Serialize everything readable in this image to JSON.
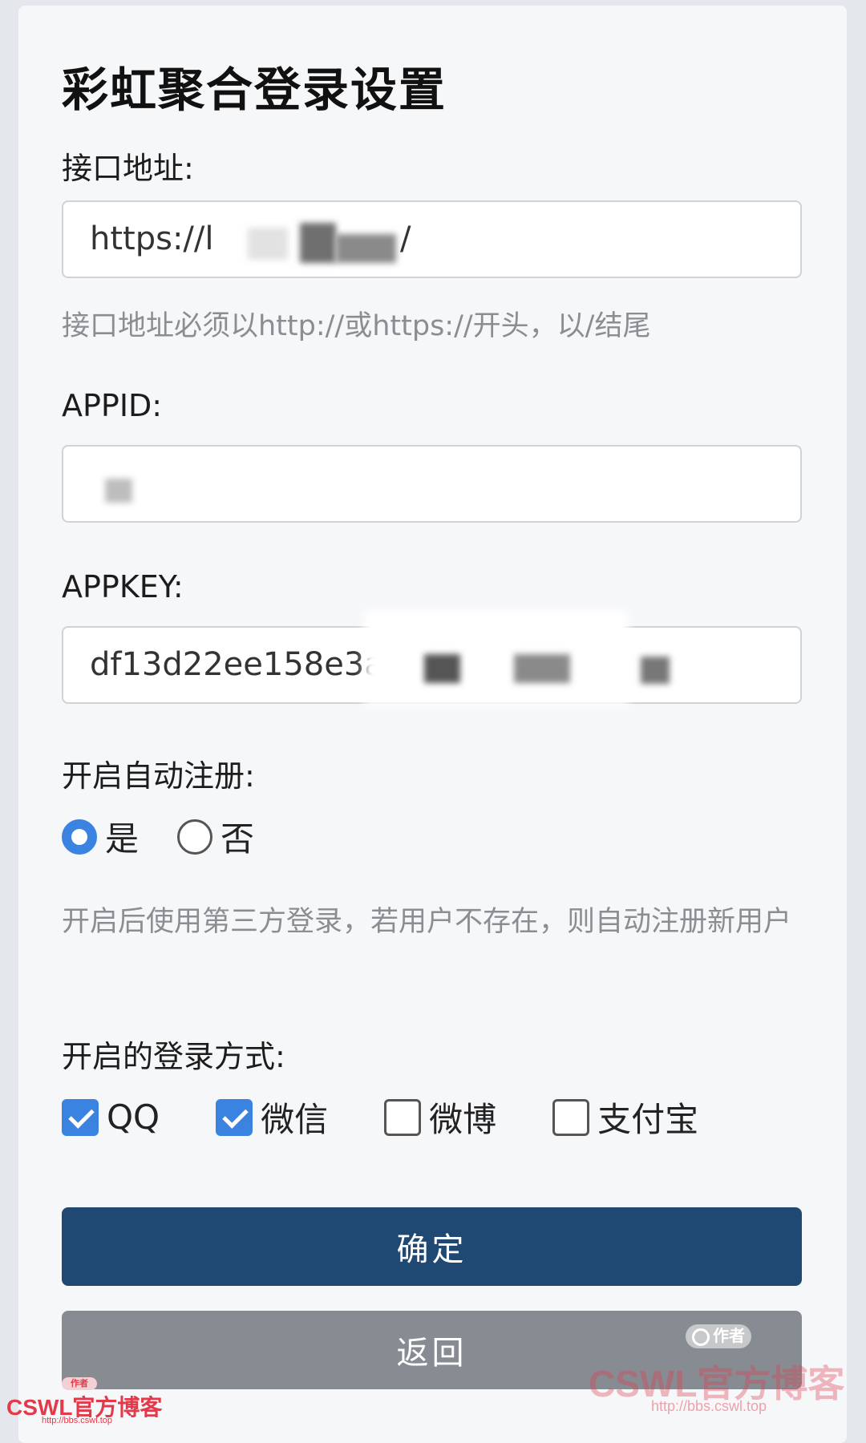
{
  "page": {
    "title": "彩虹聚合登录设置"
  },
  "api_address": {
    "label": "接口地址:",
    "value_visible": "https://l",
    "value_tail": "/",
    "help": "接口地址必须以http://或https://开头，以/结尾"
  },
  "appid": {
    "label": "APPID:",
    "value_visible": ""
  },
  "appkey": {
    "label": "APPKEY:",
    "value_visible": "df13d22ee158e3a493ef"
  },
  "auto_register": {
    "label": "开启自动注册:",
    "options": [
      {
        "label": "是",
        "checked": true
      },
      {
        "label": "否",
        "checked": false
      }
    ],
    "help": "开启后使用第三方登录，若用户不存在，则自动注册新用户"
  },
  "login_methods": {
    "label": "开启的登录方式:",
    "options": [
      {
        "label": "QQ",
        "checked": true
      },
      {
        "label": "微信",
        "checked": true
      },
      {
        "label": "微博",
        "checked": false
      },
      {
        "label": "支付宝",
        "checked": false
      }
    ]
  },
  "buttons": {
    "confirm": "确定",
    "back": "返回"
  },
  "watermarks": {
    "brand": "CSWL官方博客",
    "url": "http://bbs.cswl.top",
    "author_tag": "作者"
  },
  "colors": {
    "primary": "#1f4873",
    "secondary": "#878c93",
    "accent": "#3a83e0",
    "watermark": "#e23a4a"
  }
}
